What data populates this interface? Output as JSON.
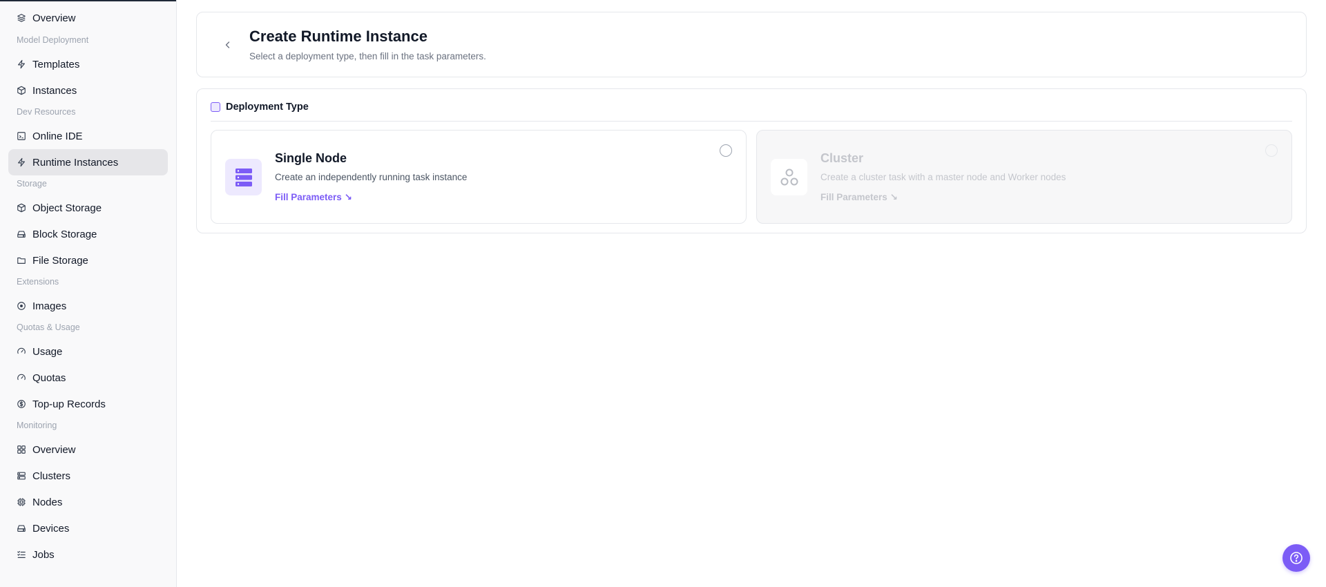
{
  "sidebar": {
    "items": [
      {
        "label": "Overview",
        "icon": "layers-icon"
      },
      {
        "label": "Templates",
        "icon": "bolt-icon"
      },
      {
        "label": "Instances",
        "icon": "cube-icon"
      },
      {
        "label": "Online IDE",
        "icon": "code-window-icon"
      },
      {
        "label": "Runtime Instances",
        "icon": "bolt-icon",
        "active": true
      },
      {
        "label": "Object Storage",
        "icon": "box-icon"
      },
      {
        "label": "Block Storage",
        "icon": "drive-icon"
      },
      {
        "label": "File Storage",
        "icon": "folder-icon"
      },
      {
        "label": "Images",
        "icon": "disc-icon"
      },
      {
        "label": "Usage",
        "icon": "gauge-icon"
      },
      {
        "label": "Quotas",
        "icon": "gauge-icon"
      },
      {
        "label": "Top-up Records",
        "icon": "dollar-icon"
      },
      {
        "label": "Overview",
        "icon": "grid-icon"
      },
      {
        "label": "Clusters",
        "icon": "server-icon"
      },
      {
        "label": "Nodes",
        "icon": "chip-icon"
      },
      {
        "label": "Devices",
        "icon": "drive-icon"
      },
      {
        "label": "Jobs",
        "icon": "checklist-icon"
      }
    ],
    "sections": [
      "Model Deployment",
      "Dev Resources",
      "Storage",
      "Extensions",
      "Quotas & Usage",
      "Monitoring"
    ]
  },
  "header": {
    "title": "Create Runtime Instance",
    "subtitle": "Select a deployment type, then fill in the task parameters."
  },
  "deployment": {
    "section_title": "Deployment Type",
    "options": [
      {
        "title": "Single Node",
        "description": "Create an independently running task instance",
        "link": "Fill Parameters ↘",
        "icon": "server-stack-icon",
        "selected": false,
        "disabled": false
      },
      {
        "title": "Cluster",
        "description": "Create a cluster task with a master node and Worker nodes",
        "link": "Fill Parameters ↘",
        "icon": "cluster-icon",
        "selected": false,
        "disabled": true
      }
    ]
  },
  "colors": {
    "accent": "#7c5cf6",
    "accent_light": "#ede9fe",
    "disabled_text": "#c4c6cc",
    "active_nav_bg": "#e6e6e9"
  }
}
